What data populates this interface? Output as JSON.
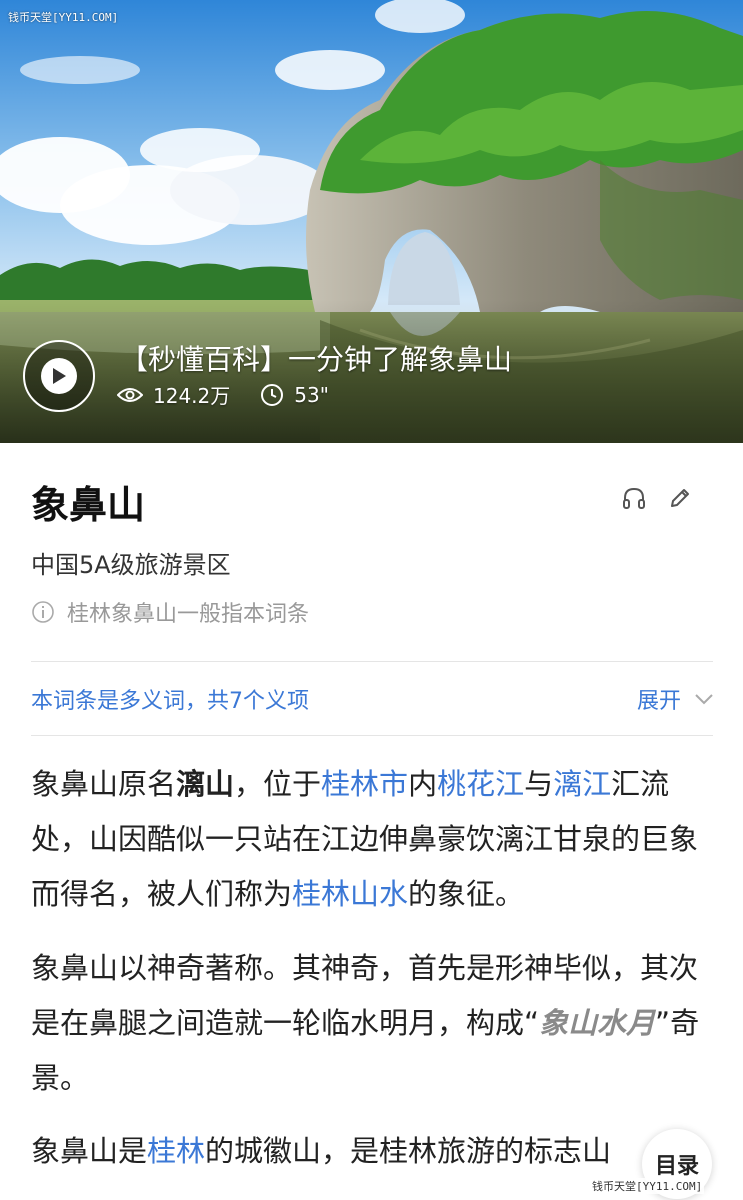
{
  "watermark": "钱币天堂[YY11.COM]",
  "video": {
    "title": "【秒懂百科】一分钟了解象鼻山",
    "views": "124.2万",
    "duration": "53\""
  },
  "entry": {
    "title": "象鼻山",
    "subtitle": "中国5A级旅游景区",
    "note": "桂林象鼻山一般指本词条"
  },
  "polysemy": {
    "text": "本词条是多义词，共7个义项",
    "expand": "展开"
  },
  "paragraphs": {
    "p1": {
      "t1": "象鼻山原名",
      "bold1": "漓山",
      "t2": "，位于",
      "link1": "桂林市",
      "t3": "内",
      "link2": "桃花江",
      "t4": "与",
      "link3": "漓江",
      "t5": "汇流处，山因酷似一只站在江边伸鼻豪饮漓江甘泉的巨象而得名，被人们称为",
      "link4": "桂林山水",
      "t6": "的象征。"
    },
    "p2": {
      "t1": "象鼻山以神奇著称。其神奇，首先是形神毕似，其次是在鼻腿之间造就一轮临水明月，构成“",
      "em1": "象山水月",
      "t2": "”奇景。"
    },
    "p3": {
      "t1": "象鼻山是",
      "link1": "桂林",
      "t2": "的城徽山，是桂林旅游的标志山"
    }
  },
  "toc_label": "目录",
  "icons": {
    "play": "play-icon",
    "views": "eye-icon",
    "duration": "clock-icon",
    "listen": "headphones-icon",
    "edit": "pencil-icon",
    "info": "info-icon",
    "expand": "chevron-down-icon"
  },
  "colors": {
    "link": "#3b78d6",
    "muted": "#999999"
  }
}
